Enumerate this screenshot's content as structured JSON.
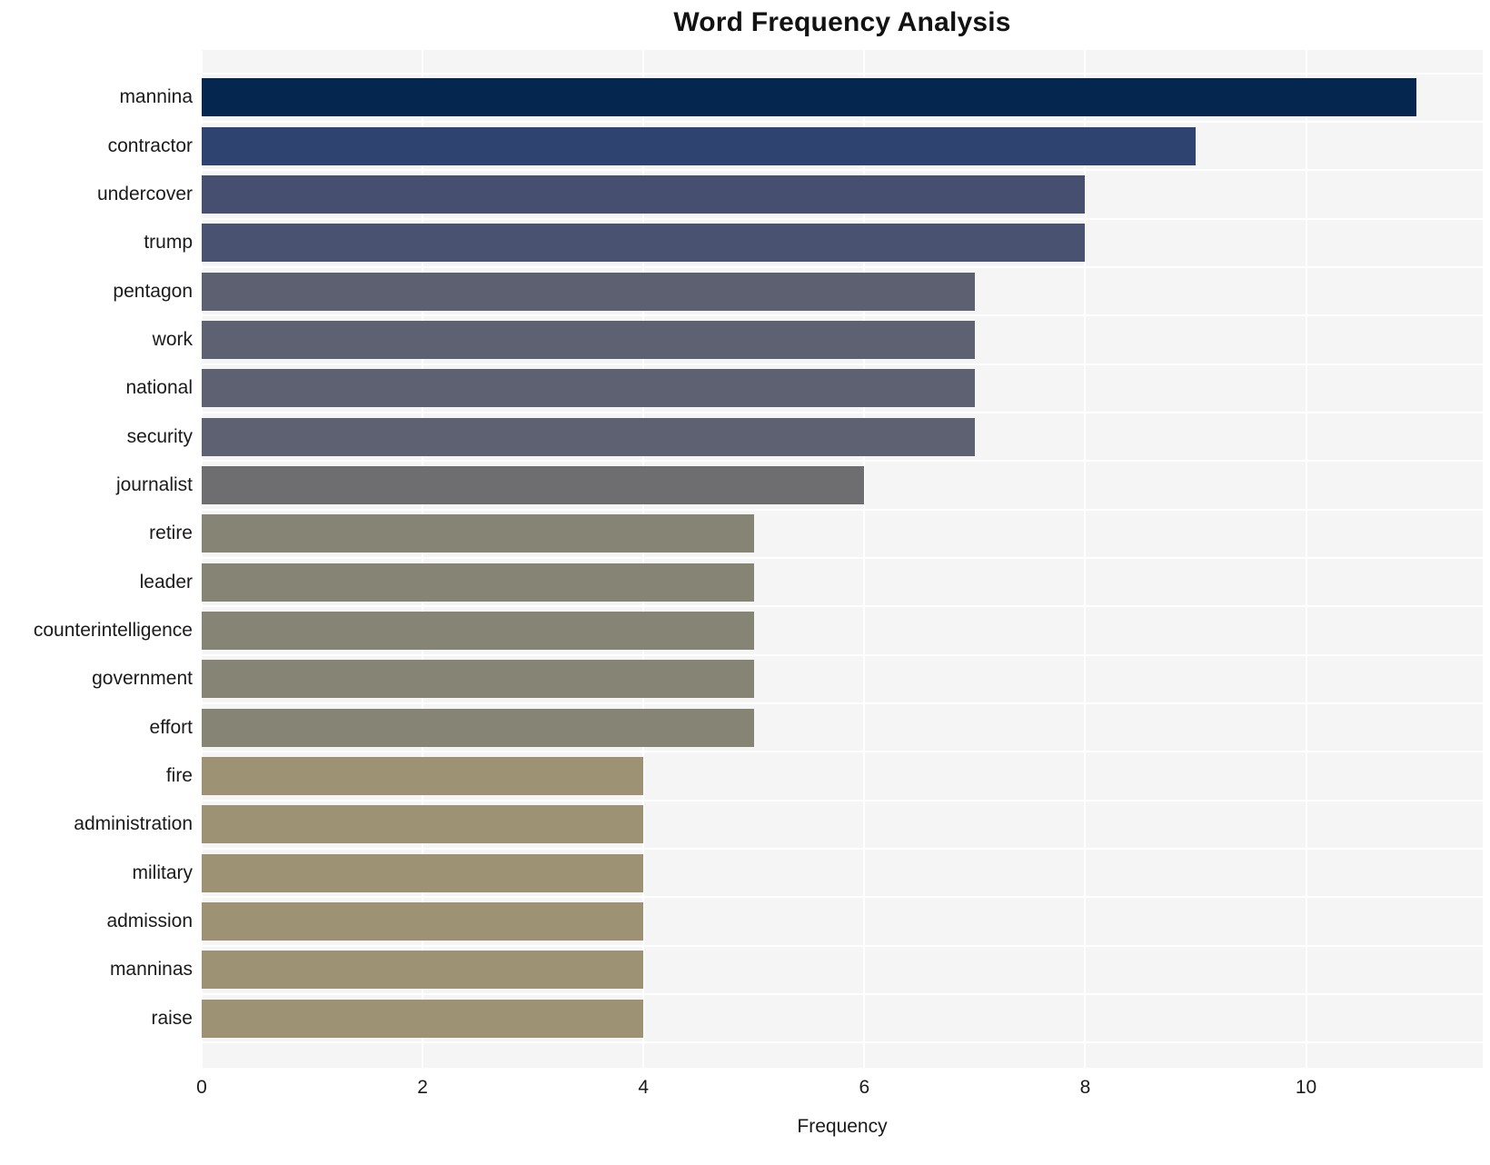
{
  "chart_data": {
    "type": "bar",
    "orientation": "horizontal",
    "title": "Word Frequency Analysis",
    "xlabel": "Frequency",
    "ylabel": "",
    "xlim": [
      0,
      11.6
    ],
    "xticks": [
      0,
      2,
      4,
      6,
      8,
      10
    ],
    "xtick_labels": [
      "0",
      "2",
      "4",
      "6",
      "8",
      "10"
    ],
    "grid": true,
    "legend": "none",
    "categories": [
      "mannina",
      "contractor",
      "undercover",
      "trump",
      "pentagon",
      "work",
      "national",
      "security",
      "journalist",
      "retire",
      "leader",
      "counterintelligence",
      "government",
      "effort",
      "fire",
      "administration",
      "military",
      "admission",
      "manninas",
      "raise"
    ],
    "values": [
      11,
      9,
      8,
      8,
      7,
      7,
      7,
      7,
      6,
      5,
      5,
      5,
      5,
      5,
      4,
      4,
      4,
      4,
      4,
      4
    ],
    "bar_colors": [
      "#04264f",
      "#2f4370",
      "#474f70",
      "#4a5271",
      "#5d6071",
      "#5e6172",
      "#5e6172",
      "#5e6172",
      "#6e6e70",
      "#868474",
      "#868474",
      "#868474",
      "#868474",
      "#868474",
      "#9d9374",
      "#9d9374",
      "#9d9374",
      "#9d9374",
      "#9d9374",
      "#9d9374"
    ],
    "plot_background": "#f5f5f6",
    "figure_background": "#ffffff",
    "gridline_color": "#ffffff",
    "text_color": "#1b1b1b"
  }
}
